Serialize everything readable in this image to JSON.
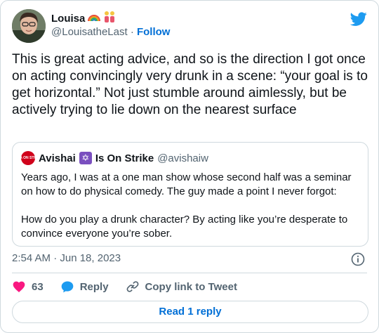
{
  "author": {
    "name": "Louisa",
    "handle": "@LouisatheLast",
    "follow_label": "Follow",
    "separator": "·",
    "emojis": [
      "rainbow",
      "two-women-holding-hands"
    ]
  },
  "tweet_text": "This is great acting advice, and so is the direction I got once on acting convincingly very drunk in a scene: “your goal is to get horizontal.” Not just stumble around aimlessly, but be actively trying to lie down on the nearest surface",
  "quoted": {
    "name": "Avishai",
    "name_suffix": "Is On Strike",
    "handle": "@avishaiw",
    "avatar_text": "WGA ON STRIKE",
    "text": "Years ago, I was at a one man show whose second half was a seminar on how to do physical comedy. The guy made a point I never forgot:\n\nHow do you play a drunk character? By acting like you’re desperate to convince everyone you’re sober."
  },
  "timestamp": "2:54 AM · Jun 18, 2023",
  "actions": {
    "like_count": "63",
    "reply_label": "Reply",
    "copy_label": "Copy link to Tweet"
  },
  "read_replies_label": "Read 1 reply",
  "colors": {
    "accent": "#1d9bf0",
    "like": "#f91880",
    "text": "#0f1419",
    "muted": "#536471",
    "border": "#cfd9de"
  },
  "icons": [
    "twitter-bird-icon",
    "info-icon",
    "heart-icon",
    "reply-bubble-icon",
    "link-icon",
    "star-of-david-icon"
  ]
}
